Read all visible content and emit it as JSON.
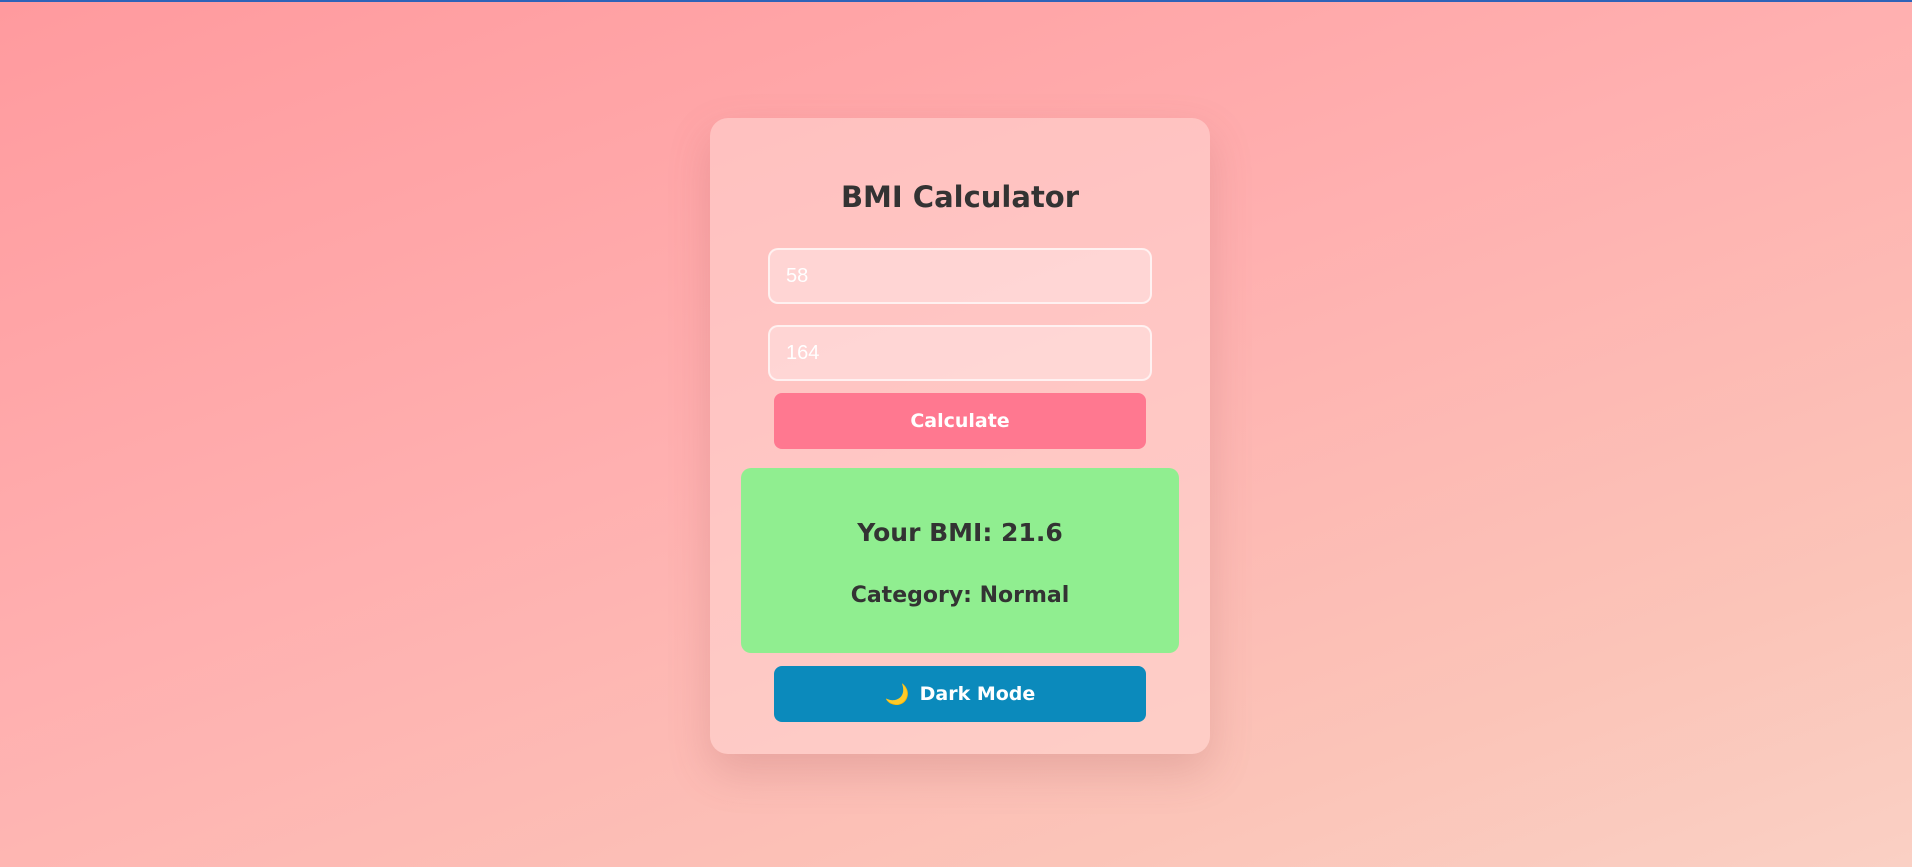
{
  "app": {
    "title": "BMI Calculator"
  },
  "form": {
    "weight_value": "58",
    "height_value": "164",
    "calculate_label": "Calculate"
  },
  "result": {
    "bmi_text": "Your BMI: 21.6",
    "category_text": "Category: Normal",
    "background_color": "#90ee90"
  },
  "theme_toggle": {
    "icon": "moon-icon",
    "icon_glyph": "🌙",
    "label": "Dark Mode"
  },
  "colors": {
    "calculate_button": "#ff7890",
    "dark_mode_button": "#0b8abc",
    "text": "#333333"
  }
}
